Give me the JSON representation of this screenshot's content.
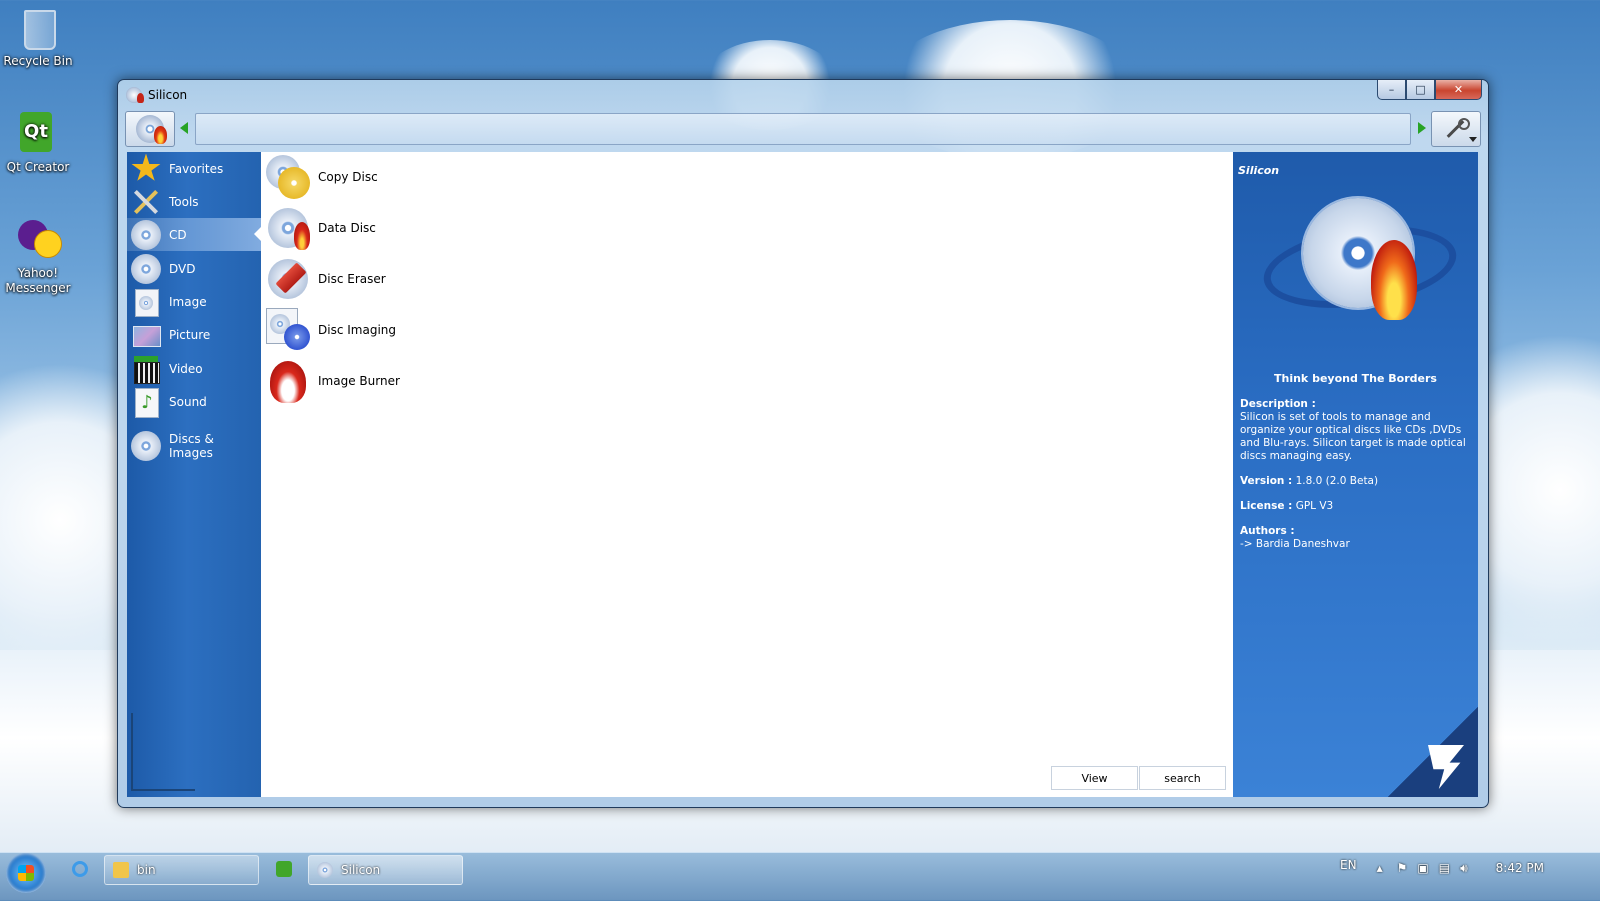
{
  "desktop": {
    "icons": [
      {
        "label": "Recycle Bin"
      },
      {
        "label": "Qt Creator"
      },
      {
        "label": "Yahoo! Messenger"
      }
    ]
  },
  "window": {
    "title": "Silicon",
    "caption_buttons": {
      "minimize": "–",
      "maximize": "□",
      "close": "✕"
    }
  },
  "toolbar": {
    "address_value": ""
  },
  "sidebar": {
    "items": [
      {
        "label": "Favorites",
        "icon": "star-icon"
      },
      {
        "label": "Tools",
        "icon": "tools-icon"
      },
      {
        "label": "CD",
        "icon": "cd-icon",
        "active": true
      },
      {
        "label": "DVD",
        "icon": "dvd-icon"
      },
      {
        "label": "Image",
        "icon": "image-icon"
      },
      {
        "label": "Picture",
        "icon": "picture-icon"
      },
      {
        "label": "Video",
        "icon": "video-icon"
      },
      {
        "label": "Sound",
        "icon": "sound-icon"
      },
      {
        "label": "Discs & Images",
        "icon": "discs-images-icon"
      }
    ]
  },
  "content": {
    "items": [
      {
        "label": "Copy Disc",
        "icon": "copy-disc-icon"
      },
      {
        "label": "Data Disc",
        "icon": "data-disc-icon"
      },
      {
        "label": "Disc Eraser",
        "icon": "disc-eraser-icon"
      },
      {
        "label": "Disc Imaging",
        "icon": "disc-imaging-icon"
      },
      {
        "label": "Image Burner",
        "icon": "image-burner-icon"
      }
    ],
    "buttons": {
      "view": "View",
      "search": "search"
    }
  },
  "info": {
    "brand": "Silicon",
    "tagline": "Think beyond The Borders",
    "description_label": "Description :",
    "description": "Silicon is set of tools to manage and organize your optical discs like CDs ,DVDs and Blu-rays. Silicon target is made optical discs managing easy.",
    "version_label": "Version :",
    "version": "1.8.0 (2.0 Beta)",
    "license_label": "License :",
    "license": "GPL V3",
    "authors_label": "Authors :",
    "authors": "-> Bardia Daneshvar"
  },
  "taskbar": {
    "tasks": [
      {
        "label": "bin"
      },
      {
        "label": "Silicon"
      }
    ],
    "language": "EN",
    "clock": "8:42 PM"
  },
  "colors": {
    "sidebar_blue": "#2463b0",
    "info_blue": "#2a6dc3",
    "nav_arrow_green": "#27a325"
  }
}
